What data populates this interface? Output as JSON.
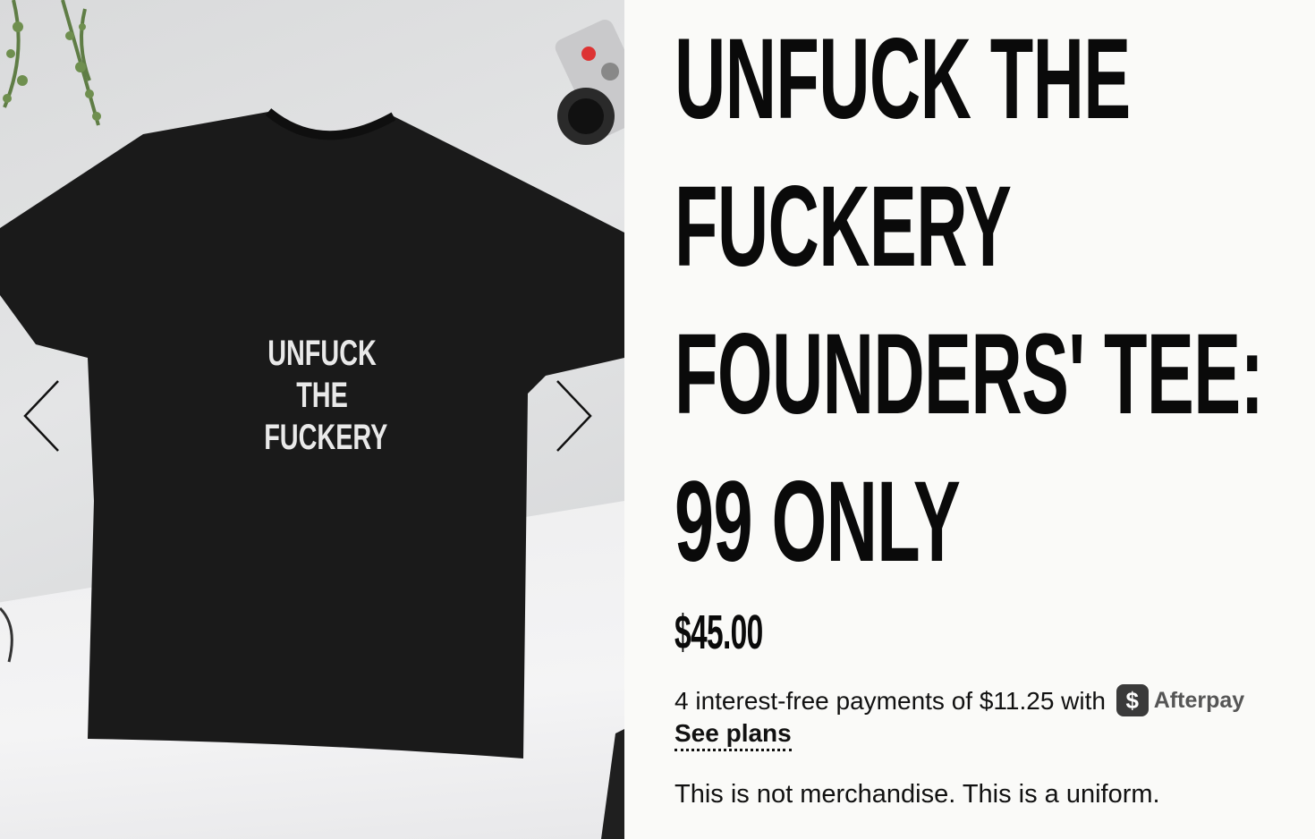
{
  "product": {
    "title_lines": [
      "UNFUCK THE",
      "FUCKERY",
      "FOUNDERS' TEE:",
      "99 ONLY"
    ],
    "price": "$45.00",
    "description": "This is not merchandise. This is a uniform."
  },
  "shirt_print": {
    "lines": [
      "UNFUCK",
      "THE",
      "FUCKERY"
    ]
  },
  "afterpay": {
    "text": "4 interest-free payments of $11.25 with",
    "badge_symbol": "$",
    "brand": "Afterpay",
    "link_label": "See plans"
  },
  "colors": {
    "text": "#0a0a0a",
    "background": "#fafaf8",
    "shirt": "#1a1a1a"
  },
  "icons": {
    "prev": "chevron-left-icon",
    "next": "chevron-right-icon"
  }
}
